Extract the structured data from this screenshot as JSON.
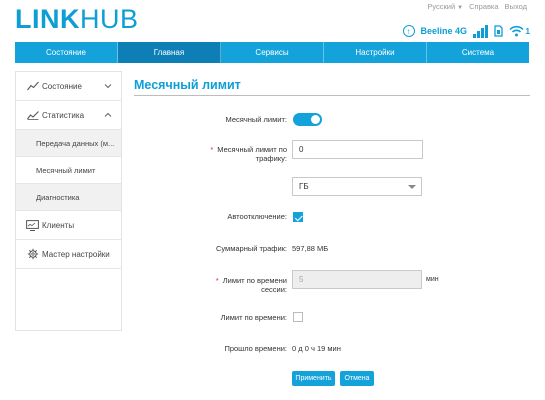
{
  "header": {
    "logo_bold": "LINK",
    "logo_light": "HUB",
    "language": "Русский",
    "help": "Справка",
    "logout": "Выход",
    "operator": "Beeline 4G",
    "wifi_clients": "1"
  },
  "nav": {
    "items": [
      "Состояние",
      "Главная",
      "Сервисы",
      "Настройки",
      "Система"
    ],
    "active": "Главная"
  },
  "sidebar": {
    "status": "Состояние",
    "statistics": "Статистика",
    "data_transfer": "Передача данных (м...",
    "monthly_limit": "Месячный лимит",
    "diagnostics": "Диагностика",
    "clients": "Клиенты",
    "setup_wizard": "Мастер настройки"
  },
  "main": {
    "title": "Месячный лимит",
    "labels": {
      "monthly_limit": "Месячный лимит:",
      "monthly_traffic_limit_1": "Месячный лимит по",
      "monthly_traffic_limit_2": "трафику:",
      "auto_off": "Автоотключение:",
      "total_traffic": "Суммарный трафик:",
      "session_time_limit_1": "Лимит по времени",
      "session_time_limit_2": "сессии:",
      "time_limit": "Лимит по времени:",
      "elapsed": "Прошло времени:"
    },
    "values": {
      "monthly_limit_enabled": true,
      "traffic_limit": "0",
      "unit": "ГБ",
      "auto_off_checked": true,
      "total_traffic": "597,88 МБ",
      "session_limit": "5",
      "session_unit": "мин",
      "time_limit_checked": false,
      "elapsed": "0 д 0 ч 19 мин"
    },
    "buttons": {
      "apply": "Применить",
      "cancel": "Отмена"
    }
  },
  "colors": {
    "accent": "#14a2da",
    "nav_active": "#0e7fb6",
    "required": "#e02727"
  }
}
